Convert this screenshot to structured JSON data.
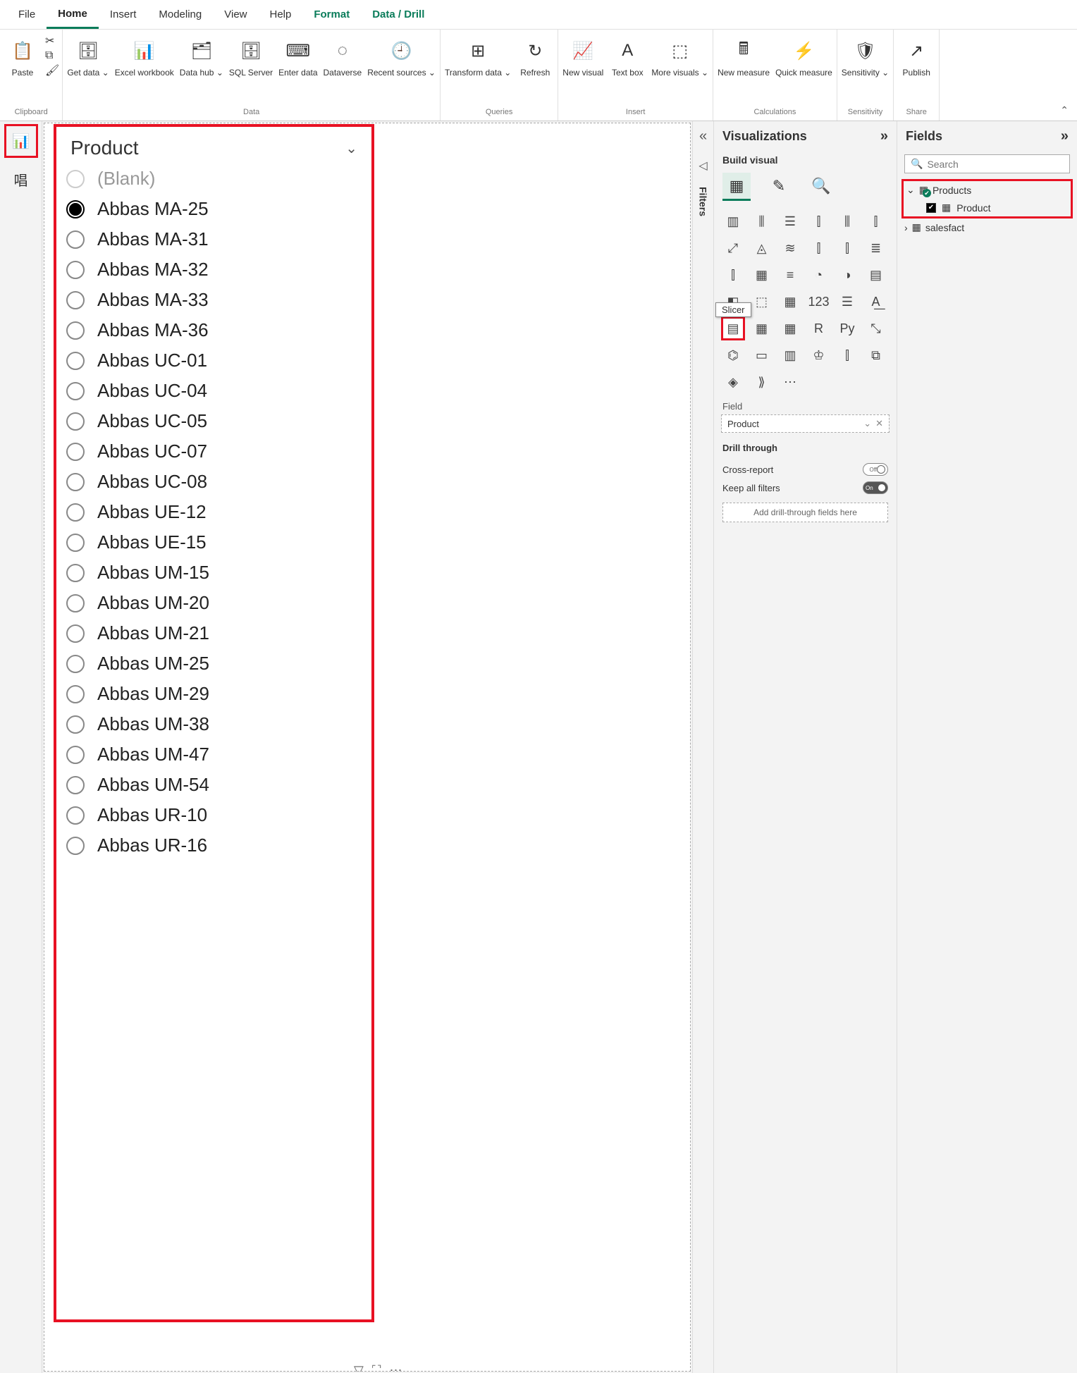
{
  "menu": {
    "tabs": [
      "File",
      "Home",
      "Insert",
      "Modeling",
      "View",
      "Help",
      "Format",
      "Data / Drill"
    ],
    "active": "Home",
    "context_start": 6
  },
  "ribbon": {
    "groups": [
      {
        "label": "Clipboard",
        "buttons": [
          {
            "name": "paste",
            "label": "Paste",
            "icon": "📋"
          }
        ],
        "small": [
          {
            "name": "cut",
            "icon": "✂"
          },
          {
            "name": "copy",
            "icon": "⧉"
          },
          {
            "name": "format-painter",
            "icon": "🖌"
          }
        ]
      },
      {
        "label": "Data",
        "buttons": [
          {
            "name": "get-data",
            "label": "Get\ndata ⌄",
            "icon": "🗄"
          },
          {
            "name": "excel-workbook",
            "label": "Excel\nworkbook",
            "icon": "📊"
          },
          {
            "name": "data-hub",
            "label": "Data\nhub ⌄",
            "icon": "🗂"
          },
          {
            "name": "sql-server",
            "label": "SQL\nServer",
            "icon": "🗄"
          },
          {
            "name": "enter-data",
            "label": "Enter\ndata",
            "icon": "⌨"
          },
          {
            "name": "dataverse",
            "label": "Dataverse",
            "icon": "◌"
          },
          {
            "name": "recent-sources",
            "label": "Recent\nsources ⌄",
            "icon": "🕘"
          }
        ]
      },
      {
        "label": "Queries",
        "buttons": [
          {
            "name": "transform-data",
            "label": "Transform\ndata ⌄",
            "icon": "⊞"
          },
          {
            "name": "refresh",
            "label": "Refresh",
            "icon": "↻"
          }
        ]
      },
      {
        "label": "Insert",
        "buttons": [
          {
            "name": "new-visual",
            "label": "New\nvisual",
            "icon": "📈"
          },
          {
            "name": "text-box",
            "label": "Text\nbox",
            "icon": "A"
          },
          {
            "name": "more-visuals",
            "label": "More\nvisuals ⌄",
            "icon": "⬚"
          }
        ]
      },
      {
        "label": "Calculations",
        "buttons": [
          {
            "name": "new-measure",
            "label": "New\nmeasure",
            "icon": "🖩"
          },
          {
            "name": "quick-measure",
            "label": "Quick\nmeasure",
            "icon": "⚡"
          }
        ]
      },
      {
        "label": "Sensitivity",
        "buttons": [
          {
            "name": "sensitivity",
            "label": "Sensitivity\n⌄",
            "icon": "🛡"
          }
        ]
      },
      {
        "label": "Share",
        "buttons": [
          {
            "name": "publish",
            "label": "Publish",
            "icon": "↗"
          }
        ]
      }
    ]
  },
  "left_rail": {
    "items": [
      {
        "name": "report-view",
        "icon": "📊",
        "active": true
      },
      {
        "name": "model-view",
        "icon": "唱",
        "active": false
      }
    ]
  },
  "slicer": {
    "title": "Product",
    "items": [
      {
        "label": "(Blank)",
        "selected": false,
        "blank": true
      },
      {
        "label": "Abbas MA-25",
        "selected": true
      },
      {
        "label": "Abbas MA-31",
        "selected": false
      },
      {
        "label": "Abbas MA-32",
        "selected": false
      },
      {
        "label": "Abbas MA-33",
        "selected": false
      },
      {
        "label": "Abbas MA-36",
        "selected": false
      },
      {
        "label": "Abbas UC-01",
        "selected": false
      },
      {
        "label": "Abbas UC-04",
        "selected": false
      },
      {
        "label": "Abbas UC-05",
        "selected": false
      },
      {
        "label": "Abbas UC-07",
        "selected": false
      },
      {
        "label": "Abbas UC-08",
        "selected": false
      },
      {
        "label": "Abbas UE-12",
        "selected": false
      },
      {
        "label": "Abbas UE-15",
        "selected": false
      },
      {
        "label": "Abbas UM-15",
        "selected": false
      },
      {
        "label": "Abbas UM-20",
        "selected": false
      },
      {
        "label": "Abbas UM-21",
        "selected": false
      },
      {
        "label": "Abbas UM-25",
        "selected": false
      },
      {
        "label": "Abbas UM-29",
        "selected": false
      },
      {
        "label": "Abbas UM-38",
        "selected": false
      },
      {
        "label": "Abbas UM-47",
        "selected": false
      },
      {
        "label": "Abbas UM-54",
        "selected": false
      },
      {
        "label": "Abbas UR-10",
        "selected": false
      },
      {
        "label": "Abbas UR-16",
        "selected": false
      }
    ]
  },
  "filters_label": "Filters",
  "viz": {
    "title": "Visualizations",
    "subtitle": "Build visual",
    "tooltip": "Slicer",
    "gallery_count": 40,
    "selected_index": 24,
    "field_label": "Field",
    "field_value": "Product",
    "drill": {
      "title": "Drill through",
      "cross": "Cross-report",
      "cross_state": "Off",
      "keep": "Keep all filters",
      "keep_state": "On",
      "drop": "Add drill-through fields here"
    }
  },
  "fields": {
    "title": "Fields",
    "search_placeholder": "Search",
    "tables": [
      {
        "name": "Products",
        "expanded": true,
        "highlight": true,
        "fields": [
          {
            "name": "Product",
            "checked": true
          }
        ]
      },
      {
        "name": "salesfact",
        "expanded": false,
        "highlight": false,
        "fields": []
      }
    ]
  }
}
